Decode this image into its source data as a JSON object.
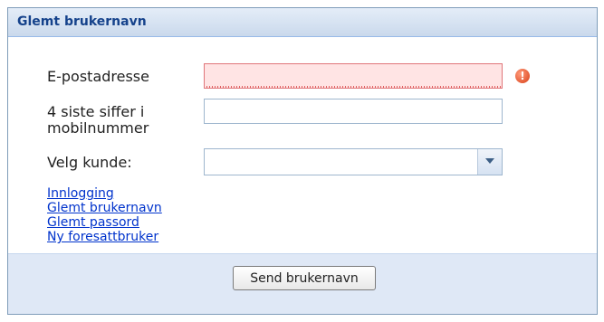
{
  "panel": {
    "title": "Glemt brukernavn"
  },
  "form": {
    "email_label": "E-postadresse",
    "email_value": "",
    "phone_label_line1": "4 siste siffer i",
    "phone_label_line2": "mobilnummer",
    "phone_value": "",
    "customer_label": "Velg kunde:",
    "customer_selected": ""
  },
  "links": [
    {
      "label": "Innlogging"
    },
    {
      "label": "Glemt brukernavn"
    },
    {
      "label": "Glemt passord"
    },
    {
      "label": "Ny foresattbruker"
    }
  ],
  "actions": {
    "submit_label": "Send brukernavn"
  },
  "icons": {
    "error": "error-icon",
    "dropdown": "chevron-down-icon"
  },
  "colors": {
    "header_text": "#15428b",
    "link": "#0033cc",
    "invalid_bg": "#ffe4e4",
    "footer_bg": "#dfe8f6"
  }
}
